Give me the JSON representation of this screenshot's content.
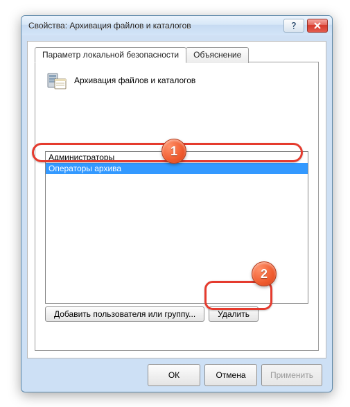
{
  "window": {
    "title": "Свойства: Архивация файлов и каталогов"
  },
  "tabs": [
    {
      "label": "Параметр локальной безопасности",
      "active": true
    },
    {
      "label": "Объяснение",
      "active": false
    }
  ],
  "policy": {
    "name": "Архивация файлов и каталогов"
  },
  "list": {
    "items": [
      {
        "label": "Администраторы",
        "selected": false
      },
      {
        "label": "Операторы архива",
        "selected": true
      }
    ]
  },
  "buttons": {
    "add": "Добавить пользователя или группу...",
    "delete": "Удалить"
  },
  "dialog_buttons": {
    "ok": "ОК",
    "cancel": "Отмена",
    "apply": "Применить"
  },
  "annotations": {
    "b1": "1",
    "b2": "2"
  },
  "icons": {
    "help": "help-icon",
    "close": "close-icon",
    "policy": "server-policy-icon"
  }
}
